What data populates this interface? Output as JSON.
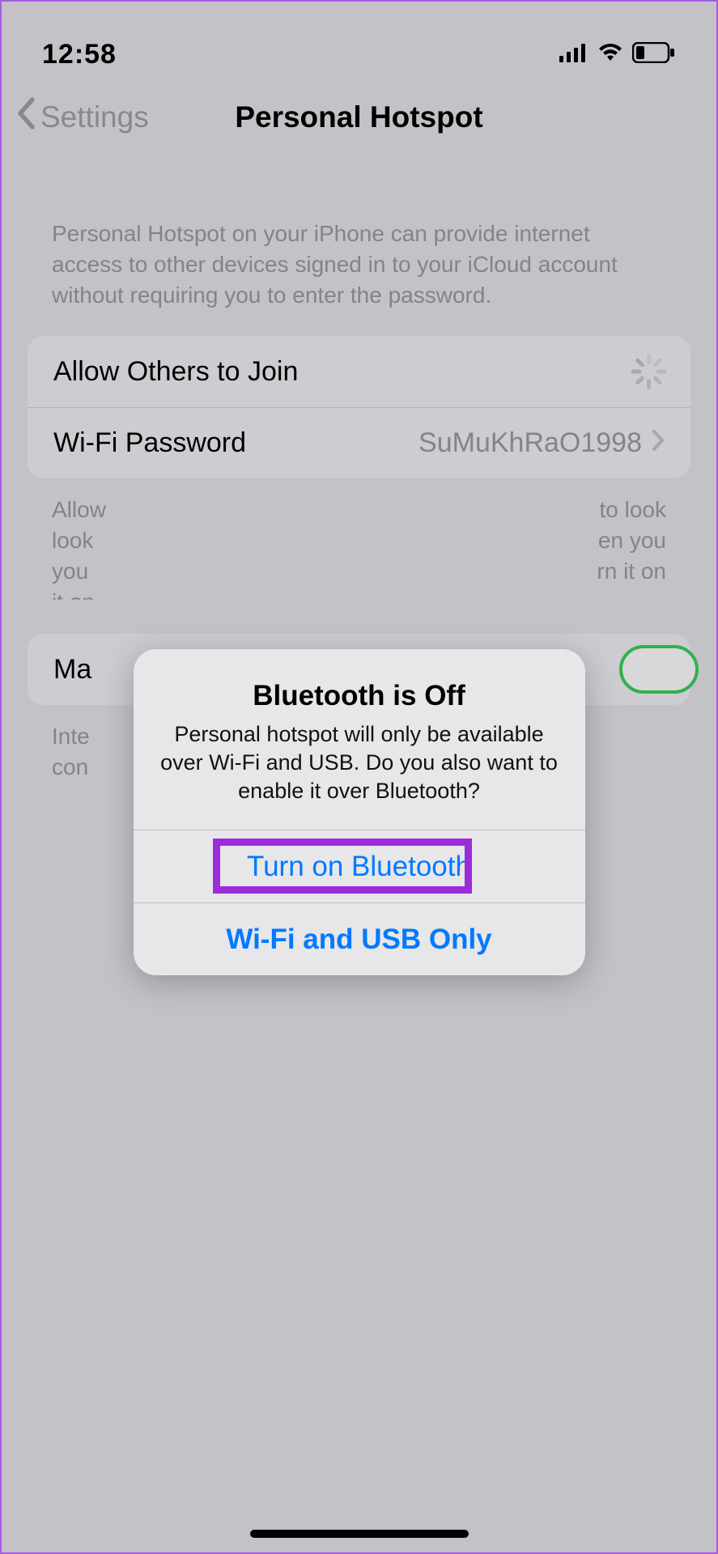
{
  "status": {
    "time": "12:58"
  },
  "nav": {
    "back_label": "Settings",
    "title": "Personal Hotspot"
  },
  "header_description": "Personal Hotspot on your iPhone can provide internet access to other devices signed in to your iCloud account without requiring you to enter the password.",
  "cells": {
    "allow_label": "Allow Others to Join",
    "wifi_pw_label": "Wi-Fi Password",
    "wifi_pw_value": "SuMuKhRaO1998"
  },
  "allow_footer_partial_left": "Allow",
  "allow_footer_partial_right": "to look",
  "allow_footer_partial_right2": "en you",
  "allow_footer_partial_right3": "rn it on",
  "maximize": {
    "label_partial": "Ma",
    "footer_partial": "Inte",
    "footer_partial2": "con"
  },
  "alert": {
    "title": "Bluetooth is Off",
    "message": "Personal hotspot will only be available over Wi-Fi and USB. Do you also want to enable it over Bluetooth?",
    "action_primary": "Turn on Bluetooth",
    "action_secondary": "Wi-Fi and USB Only"
  }
}
